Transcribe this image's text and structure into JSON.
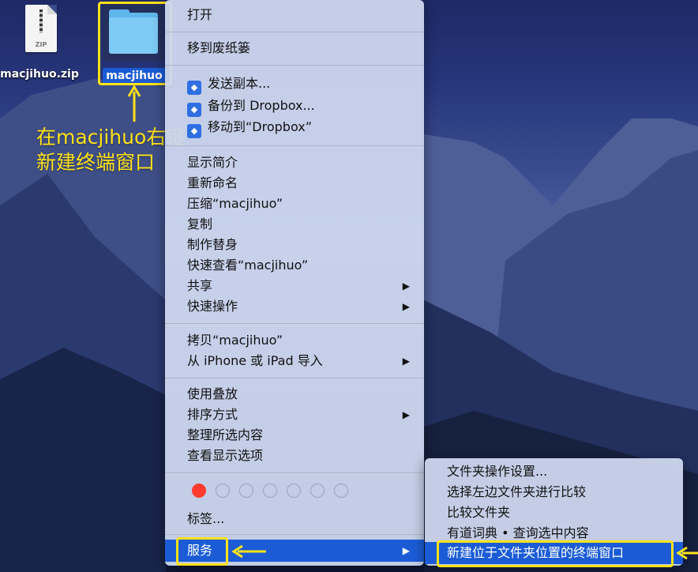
{
  "desktop": {
    "zip_file": {
      "label": "macjihuo.zip",
      "badge": "ZIP"
    },
    "folder": {
      "label": "macjihuo"
    }
  },
  "annotation": {
    "line1": "在macjihuo右键",
    "line2": "新建终端窗口"
  },
  "context_menu": {
    "open": "打开",
    "trash": "移到废纸篓",
    "send_copy": "发送副本...",
    "backup_dropbox": "备份到 Dropbox...",
    "move_dropbox": "移动到“Dropbox”",
    "get_info": "显示简介",
    "rename": "重新命名",
    "compress": "压缩“macjihuo”",
    "duplicate": "复制",
    "make_alias": "制作替身",
    "quick_look": "快速查看“macjihuo”",
    "share": "共享",
    "quick_actions": "快速操作",
    "copy": "拷贝“macjihuo”",
    "import_iphone": "从 iPhone 或 iPad 导入",
    "use_stacks": "使用叠放",
    "sort_by": "排序方式",
    "clean_up": "整理所选内容",
    "view_options": "查看显示选项",
    "tags_label": "标签...",
    "services": "服务"
  },
  "services_menu": {
    "folder_actions": "文件夹操作设置...",
    "compare_left": "选择左边文件夹进行比较",
    "compare_folders": "比较文件夹",
    "youdao": "有道词典 • 查询选中内容",
    "new_terminal": "新建位于文件夹位置的终端窗口"
  },
  "colors": {
    "highlight": "#1b5cd6",
    "annotation": "#ffe21a",
    "tag_red": "#ff3b30"
  }
}
